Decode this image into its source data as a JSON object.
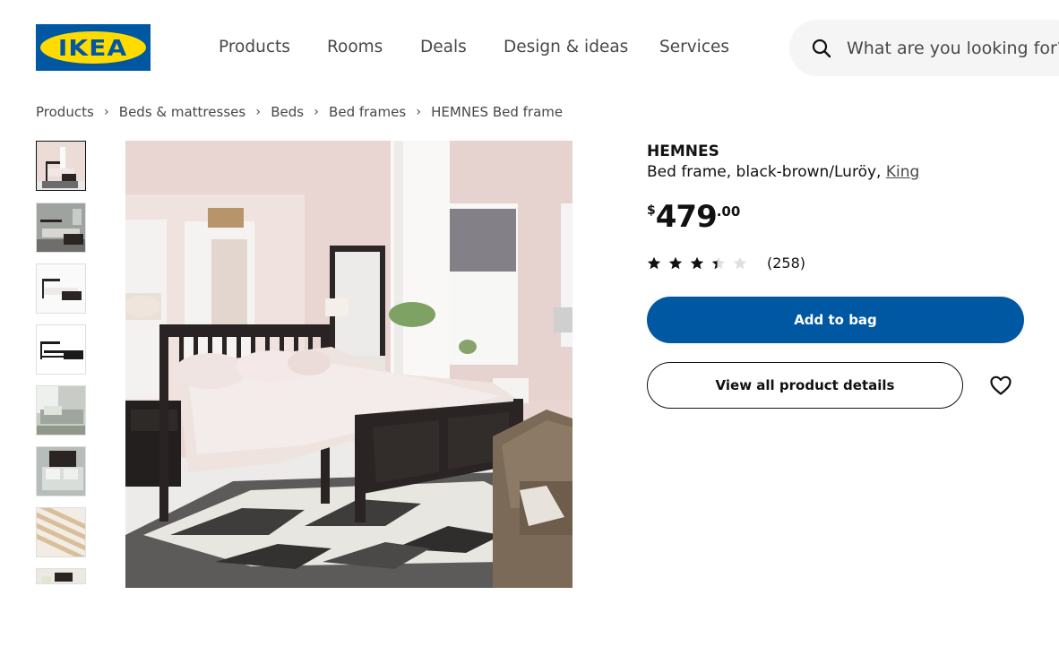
{
  "brand": {
    "logo_text": "IKEA",
    "logo_blue": "#0058a3",
    "logo_yellow": "#ffdb00"
  },
  "nav": {
    "items": [
      "Products",
      "Rooms",
      "Deals",
      "Design & ideas",
      "Services"
    ]
  },
  "search": {
    "placeholder": "What are you looking for?",
    "icon": "search-icon"
  },
  "breadcrumb": [
    "Products",
    "Beds & mattresses",
    "Beds",
    "Bed frames",
    "HEMNES Bed frame"
  ],
  "product": {
    "name": "HEMNES",
    "description": "Bed frame, black-brown/Luröy, ",
    "size_link": "King",
    "price": {
      "currency": "$",
      "integer": "479",
      "decimal": ".00"
    },
    "rating": {
      "value": 3.4,
      "max": 5,
      "count_label": "(258)"
    }
  },
  "actions": {
    "add_to_bag": "Add to bag",
    "view_details": "View all product details",
    "wishlist_icon": "heart-icon"
  },
  "gallery": {
    "thumbnail_count": 8,
    "selected_index": 0
  },
  "colors": {
    "accent": "#0058a3",
    "text": "#111111",
    "muted": "#484848",
    "search_bg": "#f5f5f5"
  }
}
